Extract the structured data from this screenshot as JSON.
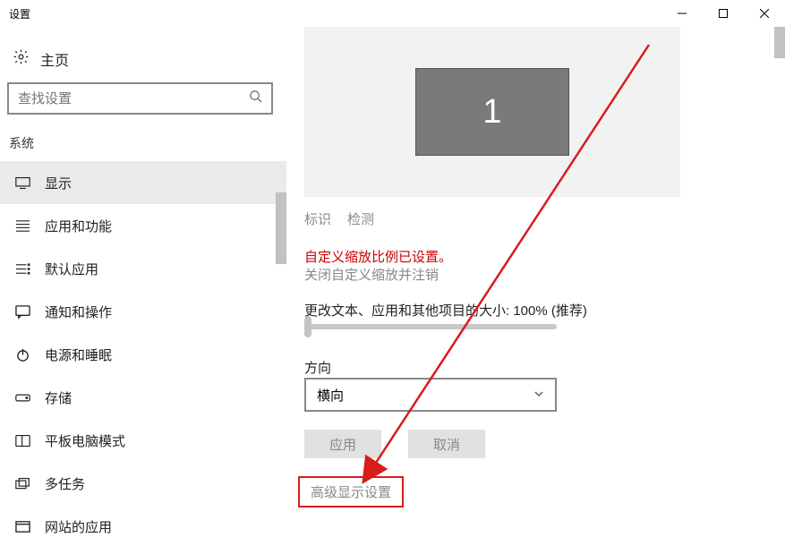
{
  "window": {
    "title": "设置"
  },
  "sidebar": {
    "home_label": "主页",
    "search_placeholder": "查找设置",
    "group_label": "系统",
    "items": [
      {
        "label": "显示"
      },
      {
        "label": "应用和功能"
      },
      {
        "label": "默认应用"
      },
      {
        "label": "通知和操作"
      },
      {
        "label": "电源和睡眠"
      },
      {
        "label": "存储"
      },
      {
        "label": "平板电脑模式"
      },
      {
        "label": "多任务"
      },
      {
        "label": "网站的应用"
      }
    ]
  },
  "main": {
    "monitor_number": "1",
    "identify_label": "标识",
    "detect_label": "检测",
    "warning_text": "自定义缩放比例已设置。",
    "close_scale_text": "关闭自定义缩放并注销",
    "size_label": "更改文本、应用和其他项目的大小: 100% (推荐)",
    "direction_label": "方向",
    "direction_value": "横向",
    "apply_label": "应用",
    "cancel_label": "取消",
    "advanced_label": "高级显示设置"
  }
}
